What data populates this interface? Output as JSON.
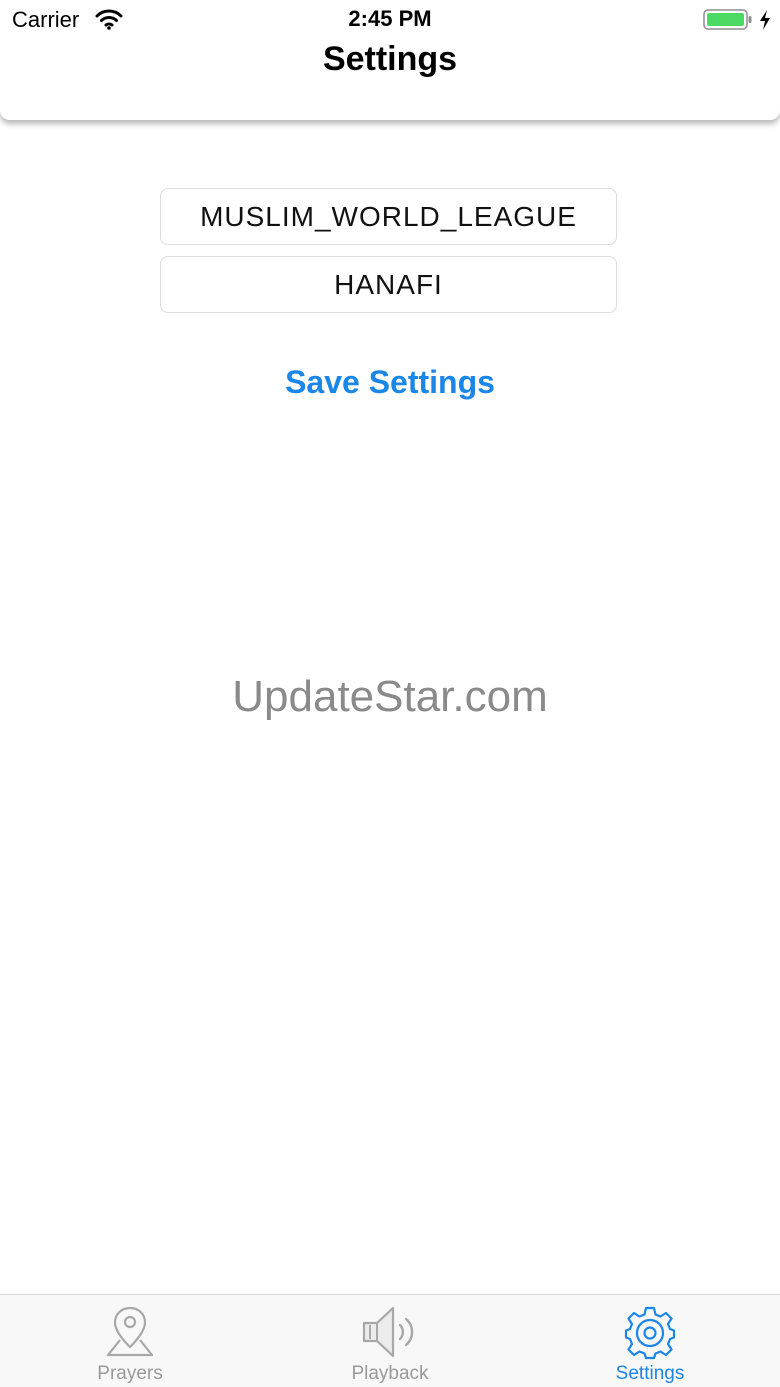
{
  "status_bar": {
    "carrier": "Carrier",
    "time": "2:45 PM",
    "battery_color": "#4cd964",
    "wifi_icon": "wifi-icon",
    "charging_icon": "charging-bolt-icon"
  },
  "header": {
    "title": "Settings"
  },
  "main": {
    "calculation_method": "MUSLIM_WORLD_LEAGUE",
    "madhab": "HANAFI",
    "save_label": "Save Settings",
    "watermark": "UpdateStar.com"
  },
  "colors": {
    "accent": "#1a86e8",
    "inactive": "#9a9a9a"
  },
  "tabbar": {
    "active": "Settings",
    "tabs": [
      {
        "label": "Prayers",
        "icon": "map-pin-icon"
      },
      {
        "label": "Playback",
        "icon": "speaker-icon"
      },
      {
        "label": "Settings",
        "icon": "gear-icon"
      }
    ]
  }
}
